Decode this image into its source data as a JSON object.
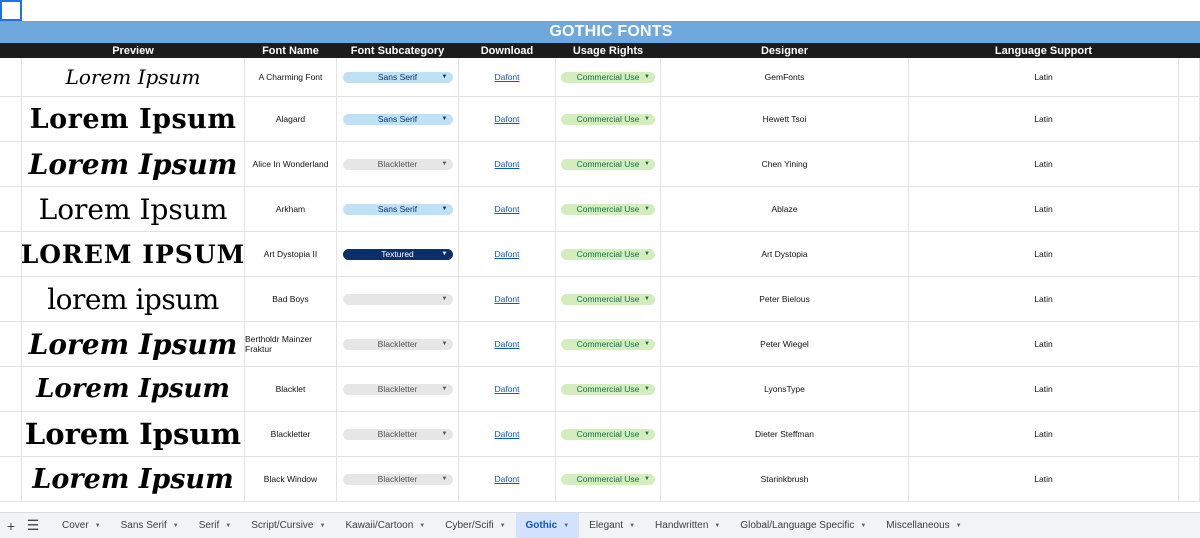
{
  "title": "GOTHIC FONTS",
  "headers": [
    "Preview",
    "Font Name",
    "Font Subcategory",
    "Download",
    "Usage Rights",
    "Designer",
    "Language Support"
  ],
  "rows": [
    {
      "preview": "Lorem Ipsum",
      "name": "A Charming Font",
      "subcategory": "Sans Serif",
      "subcategory_style": "sans",
      "download": "Dafont",
      "rights": "Commercial Use",
      "designer": "GemFonts",
      "language": "Latin"
    },
    {
      "preview": "Lorem Ipsum",
      "name": "Alagard",
      "subcategory": "Sans Serif",
      "subcategory_style": "sans",
      "download": "Dafont",
      "rights": "Commercial Use",
      "designer": "Hewett Tsoi",
      "language": "Latin"
    },
    {
      "preview": "Lorem Ipsum",
      "name": "Alice In Wonderland",
      "subcategory": "Blackletter",
      "subcategory_style": "black",
      "download": "Dafont",
      "rights": "Commercial Use",
      "designer": "Chen Yining",
      "language": "Latin"
    },
    {
      "preview": "Lorem Ipsum",
      "name": "Arkham",
      "subcategory": "Sans Serif",
      "subcategory_style": "sans",
      "download": "Dafont",
      "rights": "Commercial Use",
      "designer": "Ablaze",
      "language": "Latin"
    },
    {
      "preview": "LOREM IPSUM",
      "name": "Art Dystopia II",
      "subcategory": "Textured",
      "subcategory_style": "tex",
      "download": "Dafont",
      "rights": "Commercial Use",
      "designer": "Art Dystopia",
      "language": "Latin"
    },
    {
      "preview": "lorem ipsum",
      "name": "Bad Boys",
      "subcategory": "",
      "subcategory_style": "empty",
      "download": "Dafont",
      "rights": "Commercial Use",
      "designer": "Peter Bielous",
      "language": "Latin"
    },
    {
      "preview": "Lorem Ipsum",
      "name": "Bertholdr Mainzer Fraktur",
      "subcategory": "Blackletter",
      "subcategory_style": "black",
      "download": "Dafont",
      "rights": "Commercial Use",
      "designer": "Peter Wiegel",
      "language": "Latin"
    },
    {
      "preview": "Lorem Ipsum",
      "name": "Blacklet",
      "subcategory": "Blackletter",
      "subcategory_style": "black",
      "download": "Dafont",
      "rights": "Commercial Use",
      "designer": "LyonsType",
      "language": "Latin"
    },
    {
      "preview": "Lorem Ipsum",
      "name": "Blackletter",
      "subcategory": "Blackletter",
      "subcategory_style": "black",
      "download": "Dafont",
      "rights": "Commercial Use",
      "designer": "Dieter Steffman",
      "language": "Latin"
    },
    {
      "preview": "Lorem Ipsum",
      "name": "Black Window",
      "subcategory": "Blackletter",
      "subcategory_style": "black",
      "download": "Dafont",
      "rights": "Commercial Use",
      "designer": "Starinkbrush",
      "language": "Latin"
    }
  ],
  "tabs": [
    {
      "label": "Cover",
      "active": false
    },
    {
      "label": "Sans Serif",
      "active": false
    },
    {
      "label": "Serif",
      "active": false
    },
    {
      "label": "Script/Cursive",
      "active": false
    },
    {
      "label": "Kawaii/Cartoon",
      "active": false
    },
    {
      "label": "Cyber/Scifi",
      "active": false
    },
    {
      "label": "Gothic",
      "active": true
    },
    {
      "label": "Elegant",
      "active": false
    },
    {
      "label": "Handwritten",
      "active": false
    },
    {
      "label": "Global/Language Specific",
      "active": false
    },
    {
      "label": "Miscellaneous",
      "active": false
    }
  ],
  "icons": {
    "add_sheet": "plus-icon",
    "all_sheets": "menu-icon",
    "dropdown": "caret-down-icon"
  },
  "colors": {
    "title_band": "#6fa8dc",
    "header_band": "#1c1c1c",
    "sans_chip": "#bfe1f6",
    "blackletter_chip": "#e6e6e6",
    "textured_chip": "#0a3069",
    "commercial_chip": "#d4edbc",
    "link": "#1155cc",
    "active_tab": "#d3e3fd"
  }
}
